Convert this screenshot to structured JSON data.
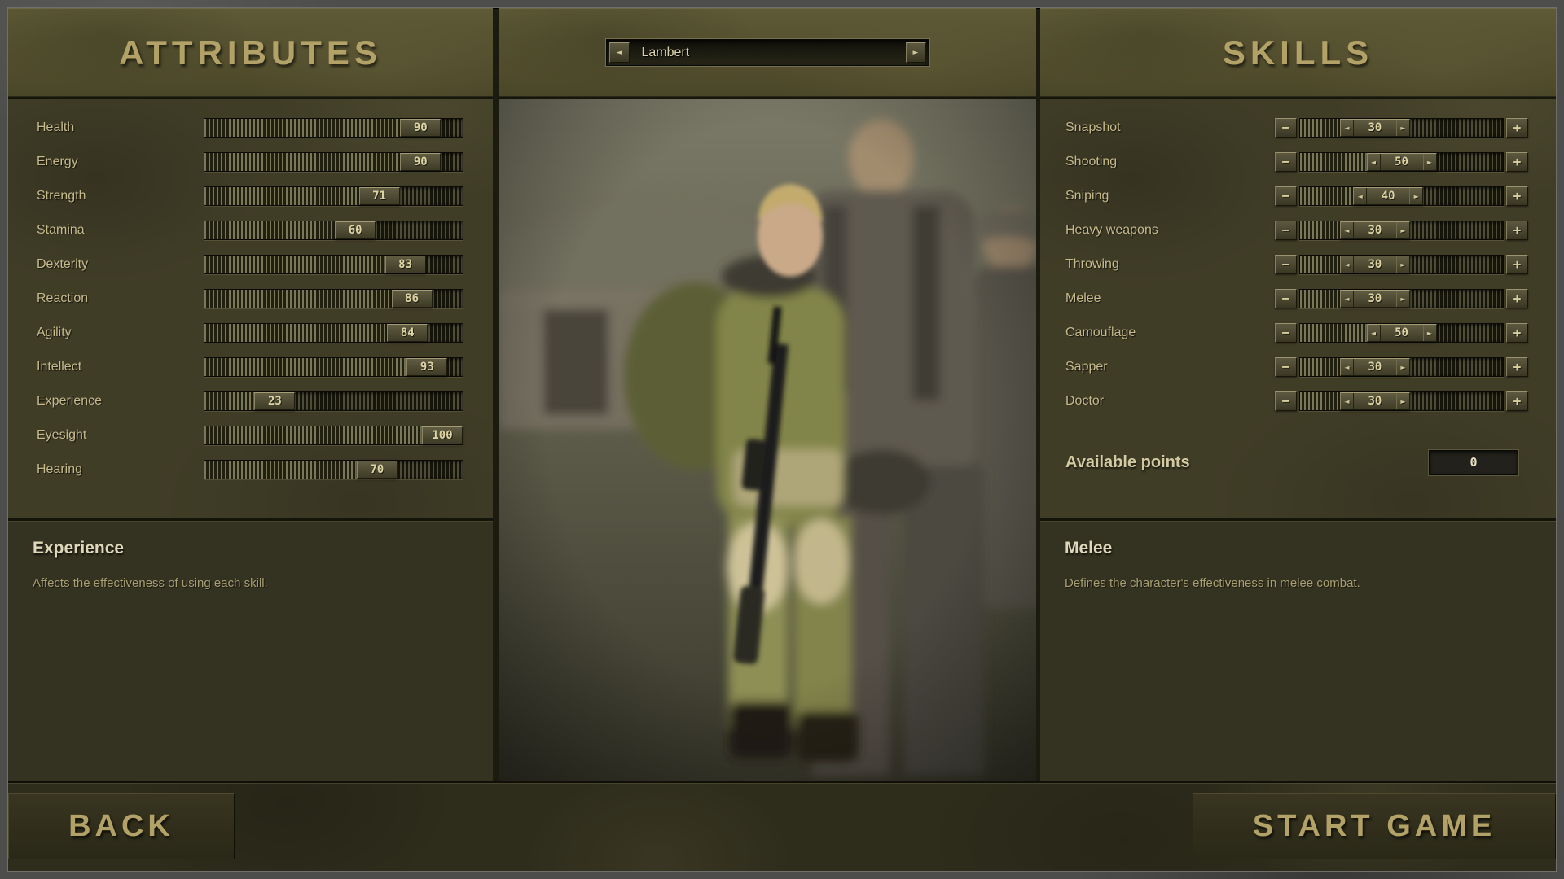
{
  "theme": {
    "frame": "#4d4d4b",
    "screen_bg": "#1c1b10",
    "panel": "#403d27",
    "info_bg": "#343220",
    "footer_bg": "#2e2c1b",
    "accent": "#b2a268",
    "label": "#c6ba8c",
    "value_text": "#ddd3a4"
  },
  "attributes_panel": {
    "title": "ATTRIBUTES",
    "items": [
      {
        "label": "Health",
        "value": 90
      },
      {
        "label": "Energy",
        "value": 90
      },
      {
        "label": "Strength",
        "value": 71
      },
      {
        "label": "Stamina",
        "value": 60
      },
      {
        "label": "Dexterity",
        "value": 83
      },
      {
        "label": "Reaction",
        "value": 86
      },
      {
        "label": "Agility",
        "value": 84
      },
      {
        "label": "Intellect",
        "value": 93
      },
      {
        "label": "Experience",
        "value": 23
      },
      {
        "label": "Eyesight",
        "value": 100
      },
      {
        "label": "Hearing",
        "value": 70
      }
    ]
  },
  "character": {
    "name": "Lambert"
  },
  "skills_panel": {
    "title": "SKILLS",
    "items": [
      {
        "label": "Snapshot",
        "value": 30
      },
      {
        "label": "Shooting",
        "value": 50
      },
      {
        "label": "Sniping",
        "value": 40
      },
      {
        "label": "Heavy weapons",
        "value": 30
      },
      {
        "label": "Throwing",
        "value": 30
      },
      {
        "label": "Melee",
        "value": 30
      },
      {
        "label": "Camouflage",
        "value": 50
      },
      {
        "label": "Sapper",
        "value": 30
      },
      {
        "label": "Doctor",
        "value": 30
      }
    ],
    "available_points_label": "Available points",
    "available_points": "0"
  },
  "attribute_info": {
    "title": "Experience",
    "description": "Affects the effectiveness of using each skill."
  },
  "skill_info": {
    "title": "Melee",
    "description": "Defines the character's effectiveness in melee combat."
  },
  "footer": {
    "back_label": "BACK",
    "start_label": "START GAME"
  }
}
